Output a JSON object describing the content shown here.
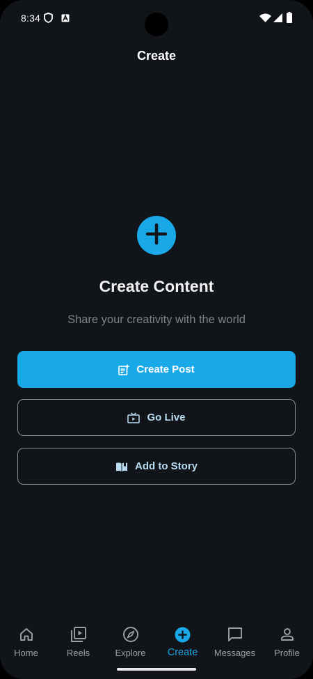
{
  "status_bar": {
    "time": "8:34",
    "icons": [
      "shield-icon",
      "accessibility-a-icon",
      "wifi-icon",
      "cellular-signal-icon",
      "battery-icon"
    ]
  },
  "header": {
    "title": "Create"
  },
  "main": {
    "icon": "plus-icon",
    "heading": "Create Content",
    "subtitle": "Share your creativity with the world",
    "buttons": {
      "create_post": {
        "label": "Create Post",
        "icon": "post-add-icon"
      },
      "go_live": {
        "label": "Go Live",
        "icon": "live-tv-icon"
      },
      "add_story": {
        "label": "Add to Story",
        "icon": "book-icon"
      }
    }
  },
  "bottom_nav": {
    "items": [
      {
        "label": "Home",
        "icon": "home-icon"
      },
      {
        "label": "Reels",
        "icon": "reels-icon"
      },
      {
        "label": "Explore",
        "icon": "compass-icon"
      },
      {
        "label": "Create",
        "icon": "plus-circle-icon",
        "active": true
      },
      {
        "label": "Messages",
        "icon": "chat-icon"
      },
      {
        "label": "Profile",
        "icon": "person-icon"
      }
    ]
  },
  "colors": {
    "accent": "#1aa9e8",
    "background": "#111418",
    "text_primary": "#f2f2f2",
    "text_muted": "#7c8288",
    "outline_button_text": "#b9dcf3"
  }
}
